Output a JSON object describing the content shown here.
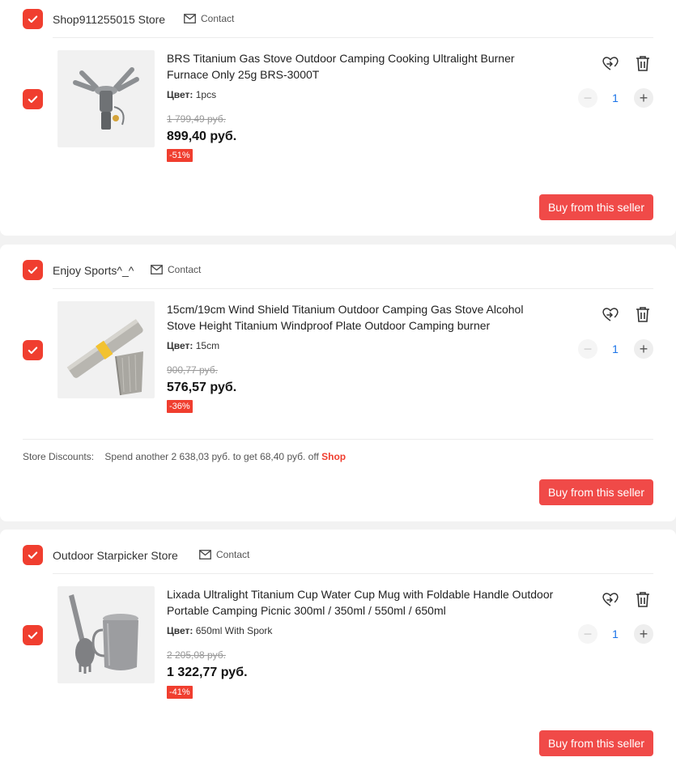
{
  "accent_color": "#f03e2f",
  "stores": [
    {
      "name": "Shop911255015 Store",
      "contact_label": "Contact",
      "product": {
        "title": "BRS Titanium Gas Stove Outdoor Camping Cooking Ultralight Burner Furnace Only 25g BRS-3000T",
        "variant_label": "Цвет:",
        "variant_value": "1pcs",
        "old_price": "1 799,49 руб.",
        "price": "899,40 руб.",
        "discount": "-51%",
        "quantity": "1"
      },
      "buy_label": "Buy from this seller"
    },
    {
      "name": "Enjoy Sports^_^",
      "contact_label": "Contact",
      "product": {
        "title": "15cm/19cm Wind Shield Titanium Outdoor Camping Gas Stove Alcohol Stove Height Titanium Windproof Plate Outdoor Camping burner",
        "variant_label": "Цвет:",
        "variant_value": "15cm",
        "old_price": "900,77 руб.",
        "price": "576,57 руб.",
        "discount": "-36%",
        "quantity": "1"
      },
      "store_discount": {
        "label": "Store Discounts:",
        "text": "Spend another 2 638,03 руб. to get 68,40 руб. off",
        "link": "Shop"
      },
      "buy_label": "Buy from this seller"
    },
    {
      "name": "Outdoor Starpicker Store",
      "contact_label": "Contact",
      "product": {
        "title": "Lixada Ultralight Titanium Cup Water Cup Mug with Foldable Handle Outdoor Portable Camping Picnic 300ml / 350ml / 550ml / 650ml",
        "variant_label": "Цвет:",
        "variant_value": "650ml With Spork",
        "old_price": "2 205,08 руб.",
        "price": "1 322,77 руб.",
        "discount": "-41%",
        "quantity": "1"
      },
      "buy_label": "Buy from this seller"
    }
  ],
  "icons": {
    "checkbox": "checkmark-icon",
    "contact": "envelope-icon",
    "wishlist": "heart-arrow-icon",
    "delete": "trash-icon"
  }
}
